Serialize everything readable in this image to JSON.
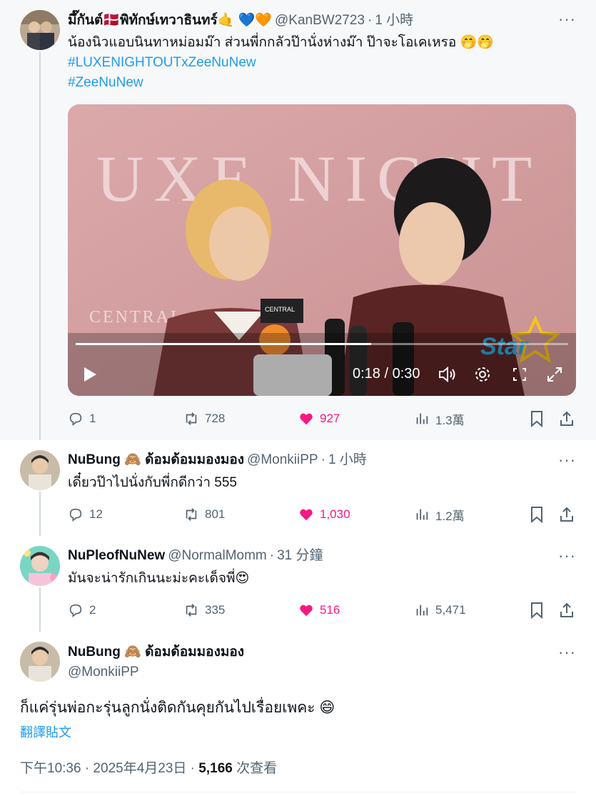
{
  "tweets": [
    {
      "name": "มึ๊กันต์🇩🇰พิทักษ์เทวาธินทร์🤙 💙🧡",
      "handle": "@KanBW2723",
      "time": "1 小時",
      "lines": [
        "น้องนิวแอบนินทาหม่อมม๊า ส่วนพี่กกลัวป๊านั่งห่างม๊า ป๊าจะโอเคเหรอ 🤭🤭"
      ],
      "hashtags": [
        "#LUXENIGHTOUTxZeeNuNew",
        "#ZeeNuNew"
      ],
      "video": {
        "backdrop_text": "UXE NIGHT",
        "logo_text": "CENTRAL",
        "time_label": "0:18 / 0:30",
        "progress": 0.6,
        "watermark": "Star"
      },
      "replies": "1",
      "retweets": "728",
      "likes": "927",
      "views": "1.3萬"
    },
    {
      "name": "NuBung 🙈 ด้อมด้อมมองมอง",
      "handle": "@MonkiiPP",
      "time": "1 小時",
      "lines": [
        "เดี๋ยวป๊าไปนั่งกับพี่กดีกว่า 555"
      ],
      "replies": "12",
      "retweets": "801",
      "likes": "1,030",
      "views": "1.2萬"
    },
    {
      "name": "NuPleofNuNew",
      "handle": "@NormalMomm",
      "time": "31 分鐘",
      "lines": [
        "มันจะน่ารักเกินนะม่ะคะเด็จพี่😍"
      ],
      "replies": "2",
      "retweets": "335",
      "likes": "516",
      "views": "5,471"
    }
  ],
  "main": {
    "name": "NuBung 🙈 ด้อมด้อมมองมอง",
    "handle": "@MonkiiPP",
    "text": "ก็แค่รุ่นพ่อกะรุ่นลูกนั่งติดกันคุยกันไปเรื่อยเพคะ 😄",
    "translate": "翻譯貼文",
    "timestamp": "下午10:36 · 2025年4月23日 · ",
    "views_count": "5,166",
    "views_label": " 次查看"
  },
  "colors": {
    "accent": "#1d9bf0",
    "like": "#f91880",
    "muted": "#536471"
  }
}
